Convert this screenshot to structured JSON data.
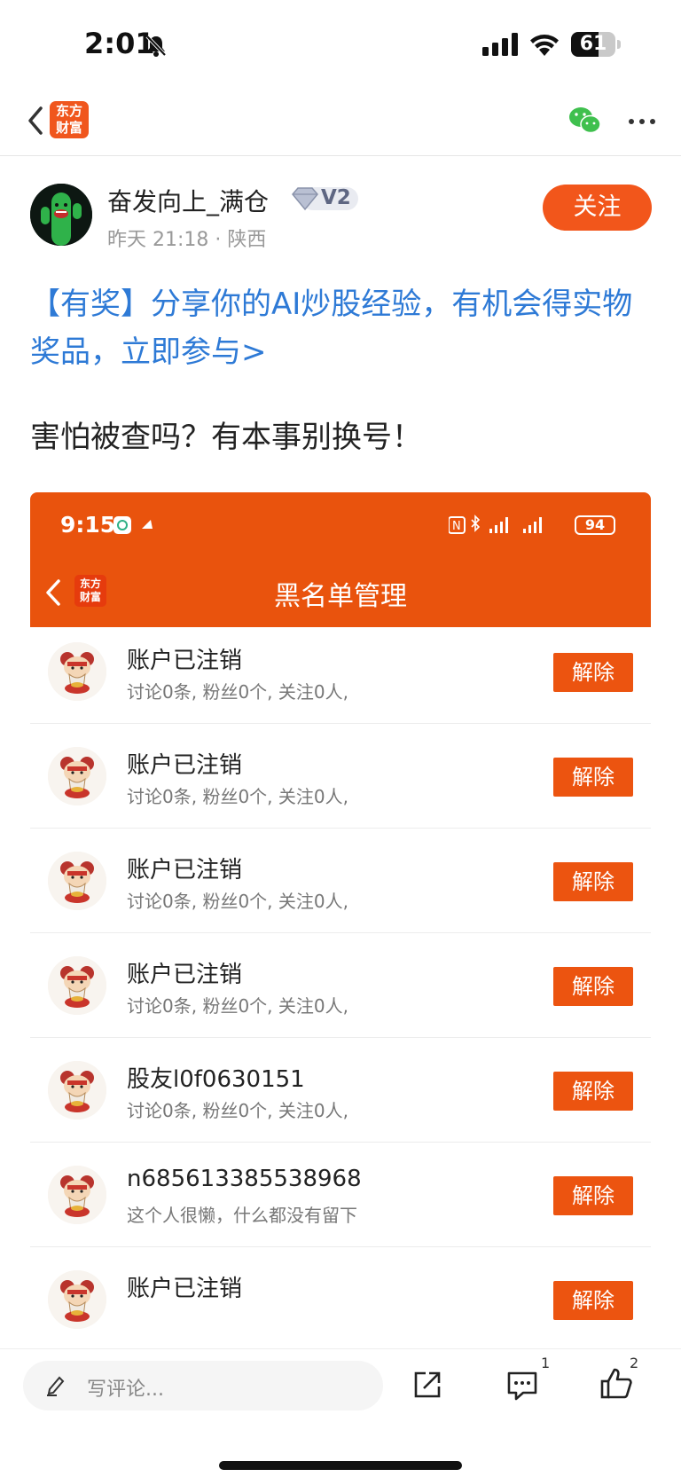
{
  "status_bar": {
    "time": "2:01",
    "battery": "61",
    "battery_level": 0.61
  },
  "nav": {
    "logo_line1": "东方",
    "logo_line2": "财富"
  },
  "author": {
    "name": "奋发向上_满仓",
    "vip_level": "V2",
    "time": "昨天 21:18",
    "location": "陕西",
    "follow_label": "关注"
  },
  "post": {
    "promo_link": "【有奖】分享你的AI炒股经验，有机会得实物奖品，立即参与>",
    "text": "害怕被查吗？有本事别换号！"
  },
  "embed": {
    "time": "9:15",
    "battery": "94",
    "logo_line1": "东方",
    "logo_line2": "财富",
    "title": "黑名单管理",
    "rows": [
      {
        "name": "",
        "desc": "讨论0条, 粉丝0个, 关注0人,",
        "action": "解除"
      },
      {
        "name": "账户已注销",
        "desc": "讨论0条, 粉丝0个, 关注0人,",
        "action": "解除"
      },
      {
        "name": "账户已注销",
        "desc": "讨论0条, 粉丝0个, 关注0人,",
        "action": "解除"
      },
      {
        "name": "账户已注销",
        "desc": "讨论0条, 粉丝0个, 关注0人,",
        "action": "解除"
      },
      {
        "name": "账户已注销",
        "desc": "讨论0条, 粉丝0个, 关注0人,",
        "action": "解除"
      },
      {
        "name": "股友l0f0630151",
        "desc": "讨论0条, 粉丝0个, 关注0人,",
        "action": "解除"
      },
      {
        "name": "n685613385538968",
        "desc": "这个人很懒，什么都没有留下",
        "action": "解除"
      },
      {
        "name": "账户已注销",
        "desc": "",
        "action": "解除"
      }
    ]
  },
  "bottom_bar": {
    "comment_placeholder": "写评论...",
    "comment_count": "1",
    "like_count": "2"
  },
  "colors": {
    "accent": "#f2561b",
    "link": "#2e7ad6",
    "embed_header": "#e9530d"
  }
}
